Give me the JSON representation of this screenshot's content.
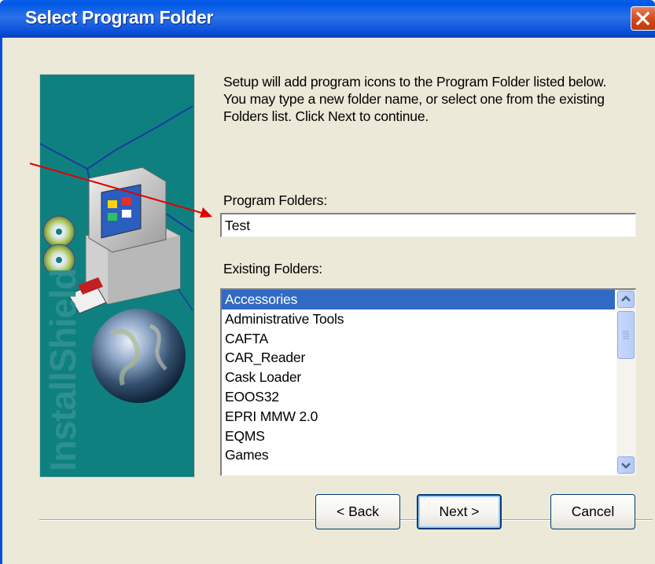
{
  "window": {
    "title": "Select Program Folder",
    "close_icon": "close-icon"
  },
  "banner": {
    "brand_text": "InstallShield"
  },
  "instruction": {
    "line1": "Setup will add program icons to the Program Folder listed below.",
    "line2": "You may type a new folder name, or select one from the existing",
    "line3": "Folders list.  Click Next to continue."
  },
  "program_folders": {
    "label": "Program Folders:",
    "value": "Test"
  },
  "existing_folders": {
    "label": "Existing Folders:",
    "items": [
      "Accessories",
      "Administrative Tools",
      "CAFTA",
      "CAR_Reader",
      "Cask Loader",
      "EOOS32",
      "EPRI MMW 2.0",
      "EQMS",
      "Games"
    ],
    "selected": "Accessories"
  },
  "buttons": {
    "back_label": "< Back",
    "next_label": "Next >",
    "cancel_label": "Cancel"
  },
  "colors": {
    "title_bar": "#0a5fe8",
    "selection": "#316ac5",
    "annotation_arrow": "#e00000",
    "banner": "#0f8080"
  }
}
